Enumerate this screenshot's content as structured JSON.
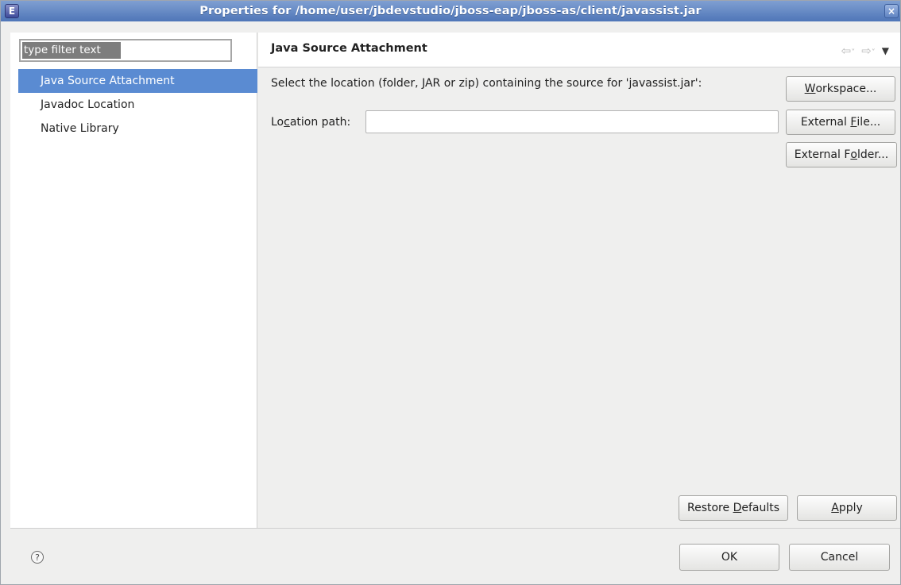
{
  "window": {
    "title": "Properties for /home/user/jbdevstudio/jboss-eap/jboss-as/client/javassist.jar",
    "app_icon_glyph": "E",
    "close_glyph": "×"
  },
  "filter": {
    "placeholder": "type filter text",
    "value": "type filter text"
  },
  "tree": {
    "items": [
      {
        "label": "Java Source Attachment",
        "selected": true
      },
      {
        "label": "Javadoc Location",
        "selected": false
      },
      {
        "label": "Native Library",
        "selected": false
      }
    ]
  },
  "page": {
    "title": "Java Source Attachment",
    "description": "Select the location (folder, JAR or zip) containing the source for 'javassist.jar':",
    "location_label": "Location path:",
    "location_value": ""
  },
  "nav": {
    "back_icon": "⇦",
    "forward_icon": "⇨",
    "menu_icon": "▼",
    "dropdown_glyph": "˅"
  },
  "buttons": {
    "workspace": "Workspace...",
    "external_file": "External File...",
    "external_folder": "External Folder...",
    "restore_defaults": "Restore Defaults",
    "apply": "Apply",
    "ok": "OK",
    "cancel": "Cancel"
  },
  "help": {
    "glyph": "?"
  },
  "colors": {
    "selection": "#5a8bd2",
    "titlebar": "#4f76b8"
  }
}
